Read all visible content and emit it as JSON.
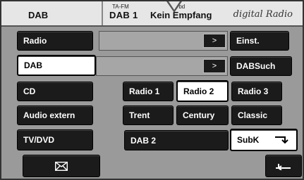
{
  "header": {
    "source_label": "DAB",
    "ta_fm_label": "TA-FM",
    "vbd_label": "Vbd",
    "station_label": "DAB 1",
    "status_text": "Kein Empfang",
    "brand_text": "digital Radio"
  },
  "left_menu": [
    {
      "id": "radio",
      "label": "Radio"
    },
    {
      "id": "dab",
      "label": "DAB"
    },
    {
      "id": "cd",
      "label": "CD"
    },
    {
      "id": "audio-extern",
      "label": "Audio extern"
    },
    {
      "id": "tv-dvd",
      "label": "TV/DVD"
    }
  ],
  "rows": {
    "row1_arrow": ">",
    "row2_arrow": ">"
  },
  "right_menu": {
    "einst": "Einst.",
    "dabsuch": "DABSuch",
    "radio3": "Radio 3",
    "classic": "Classic",
    "subk": "SubK"
  },
  "presets": {
    "radio1": "Radio 1",
    "radio2": "Radio 2",
    "trent": "Trent",
    "century": "Century",
    "dab2": "DAB 2"
  },
  "icons": {
    "envelope": "envelope-icon",
    "back": "back-arrow-icon",
    "subk": "return-arrow-icon"
  }
}
